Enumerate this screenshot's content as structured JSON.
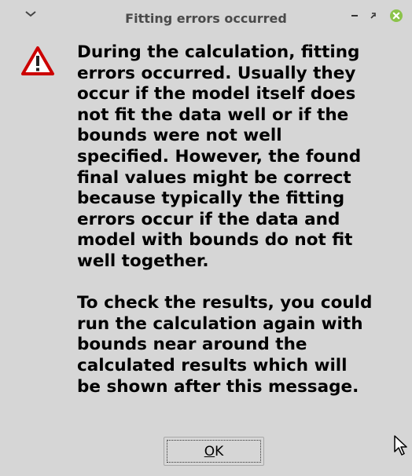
{
  "window": {
    "title": "Fitting errors occurred",
    "background": "#d6d6d6"
  },
  "titlebar_buttons": {
    "menu_icon": "chevron-down-icon",
    "minimize_icon": "minimize-icon",
    "maximize_icon": "maximize-icon",
    "close_icon": "close-icon",
    "close_color": "#8bc34a"
  },
  "dialog": {
    "icon": "warning-icon",
    "icon_color": "#cc0000",
    "message": "During the calculation, fitting\nerrors occurred. Usually they\noccur if the model itself does\nnot fit the data well or if the\nbounds were not well\nspecified. However, the found\nfinal values might be correct\nbecause typically the fitting\nerrors occur if the data and\nmodel with bounds do not fit\nwell together.\n\nTo check the results, you could\nrun the calculation again with\nbounds near around the\ncalculated results which will\nbe shown after this message."
  },
  "buttons": {
    "ok_mnemonic": "O",
    "ok_rest": "K"
  }
}
